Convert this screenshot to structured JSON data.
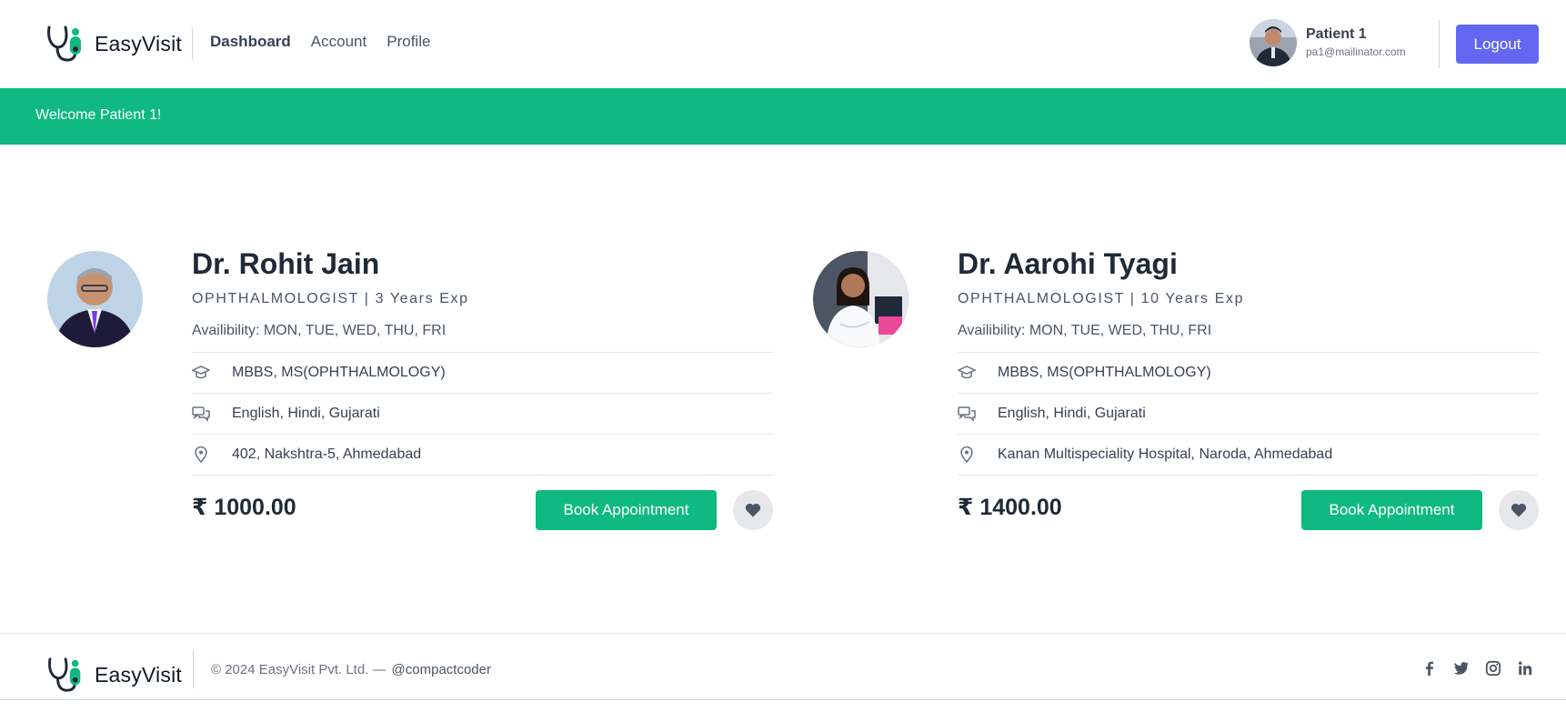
{
  "brand": {
    "name": "EasyVisit",
    "primary_color": "#10b981",
    "accent_color": "#6366f1"
  },
  "nav": {
    "items": [
      {
        "label": "Dashboard",
        "active": true
      },
      {
        "label": "Account",
        "active": false
      },
      {
        "label": "Profile",
        "active": false
      }
    ]
  },
  "user": {
    "name": "Patient 1",
    "email": "pa1@mailinator.com",
    "logout_label": "Logout"
  },
  "banner": {
    "text": "Welcome Patient 1!"
  },
  "doctors": [
    {
      "name": "Dr. Rohit Jain",
      "specialty_line": "OPHTHALMOLOGIST | 3 Years Exp",
      "availability": "Availibility: MON, TUE, WED, THU, FRI",
      "qualification": "MBBS, MS(OPHTHALMOLOGY)",
      "languages": "English, Hindi, Gujarati",
      "address": "402, Nakshtra-5, Ahmedabad",
      "fee": "₹ 1000.00",
      "book_label": "Book Appointment"
    },
    {
      "name": "Dr. Aarohi Tyagi",
      "specialty_line": "OPHTHALMOLOGIST | 10 Years Exp",
      "availability": "Availibility: MON, TUE, WED, THU, FRI",
      "qualification": "MBBS, MS(OPHTHALMOLOGY)",
      "languages": "English, Hindi, Gujarati",
      "address": "Kanan Multispeciality Hospital, Naroda, Ahmedabad",
      "fee": "₹ 1400.00",
      "book_label": "Book Appointment"
    }
  ],
  "footer": {
    "brand": "EasyVisit",
    "copyright": "© 2024 EasyVisit Pvt. Ltd. —",
    "handle": "@compactcoder",
    "socials": [
      "facebook-icon",
      "twitter-icon",
      "instagram-icon",
      "linkedin-icon"
    ]
  }
}
